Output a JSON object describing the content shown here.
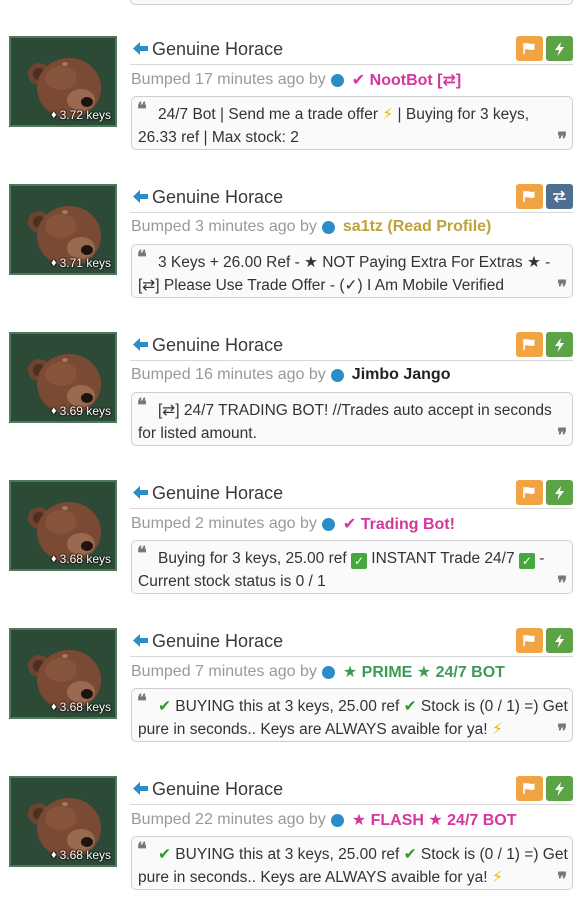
{
  "listings": [
    {
      "item_name": "Genuine Horace",
      "price": "3.72 keys",
      "bump_prefix": "Bumped 17 minutes ago by",
      "username": "✔ NootBot [⇄]",
      "username_color": "#d6369b",
      "second_button": "bolt",
      "comment_parts": [
        {
          "t": "24/7 Bot | Send me a trade offer "
        },
        {
          "t": "⚡",
          "cls": "bolt-emoji"
        },
        {
          "t": " | Buying for 3 keys, 26.33 ref | Max stock: 2"
        }
      ]
    },
    {
      "item_name": "Genuine Horace",
      "price": "3.71 keys",
      "bump_prefix": "Bumped 3 minutes ago by",
      "username": "sa1tz (Read Profile)",
      "username_color": "#c0a23a",
      "second_button": "swap",
      "comment_parts": [
        {
          "t": "3 Keys + 26.00 Ref - ★ NOT Paying Extra For Extras ★ - [⇄] Please Use Trade Offer - (✓) I Am Mobile Verified"
        }
      ]
    },
    {
      "item_name": "Genuine Horace",
      "price": "3.69 keys",
      "bump_prefix": "Bumped 16 minutes ago by",
      "username": "Jimbo Jango",
      "username_color": "#222222",
      "second_button": "bolt",
      "comment_parts": [
        {
          "t": "[⇄] 24/7 TRADING BOT! //Trades auto accept in seconds for listed amount."
        }
      ]
    },
    {
      "item_name": "Genuine Horace",
      "price": "3.68 keys",
      "bump_prefix": "Bumped 2 minutes ago by",
      "username": "✔ Trading Bot!",
      "username_color": "#d6369b",
      "second_button": "bolt",
      "comment_parts": [
        {
          "t": "Buying for 3 keys, 25.00 ref "
        },
        {
          "t": "✓",
          "cls": "green-box"
        },
        {
          "t": " INSTANT Trade 24/7 "
        },
        {
          "t": "✓",
          "cls": "green-box"
        },
        {
          "t": " - Current stock status is 0 / 1"
        }
      ]
    },
    {
      "item_name": "Genuine Horace",
      "price": "3.68 keys",
      "bump_prefix": "Bumped 7 minutes ago by",
      "username": "★ PRIME ★ 24/7 BOT",
      "username_color": "#3f9a55",
      "second_button": "bolt",
      "comment_parts": [
        {
          "t": "✔",
          "cls": "green-check"
        },
        {
          "t": " BUYING this at 3 keys, 25.00 ref "
        },
        {
          "t": "✔",
          "cls": "green-check"
        },
        {
          "t": " Stock is (0 / 1) =) Get pure in seconds.. Keys are ALWAYS avaible for ya! "
        },
        {
          "t": "⚡",
          "cls": "bolt-emoji"
        }
      ]
    },
    {
      "item_name": "Genuine Horace",
      "price": "3.68 keys",
      "bump_prefix": "Bumped 22 minutes ago by",
      "username": "★ FLASH ★ 24/7 BOT",
      "username_color": "#d6369b",
      "second_button": "bolt",
      "comment_parts": [
        {
          "t": "✔",
          "cls": "green-check"
        },
        {
          "t": " BUYING this at 3 keys, 25.00 ref "
        },
        {
          "t": "✔",
          "cls": "green-check"
        },
        {
          "t": " Stock is (0 / 1) =) Get pure in seconds.. Keys are ALWAYS avaible for ya! "
        },
        {
          "t": "⚡",
          "cls": "bolt-emoji"
        }
      ]
    }
  ],
  "icons": {
    "back": "arrow-left-icon",
    "flag": "flag-icon",
    "bolt": "bolt-icon",
    "swap": "swap-icon",
    "tag": "tag-icon"
  },
  "colors": {
    "flag_button": "#f0a443",
    "bolt_button": "#5ba345",
    "swap_button": "#4f6f8f",
    "online_dot": "#2c8cc8",
    "item_border": "#4b7a58",
    "item_bg": "#2d4a37"
  }
}
